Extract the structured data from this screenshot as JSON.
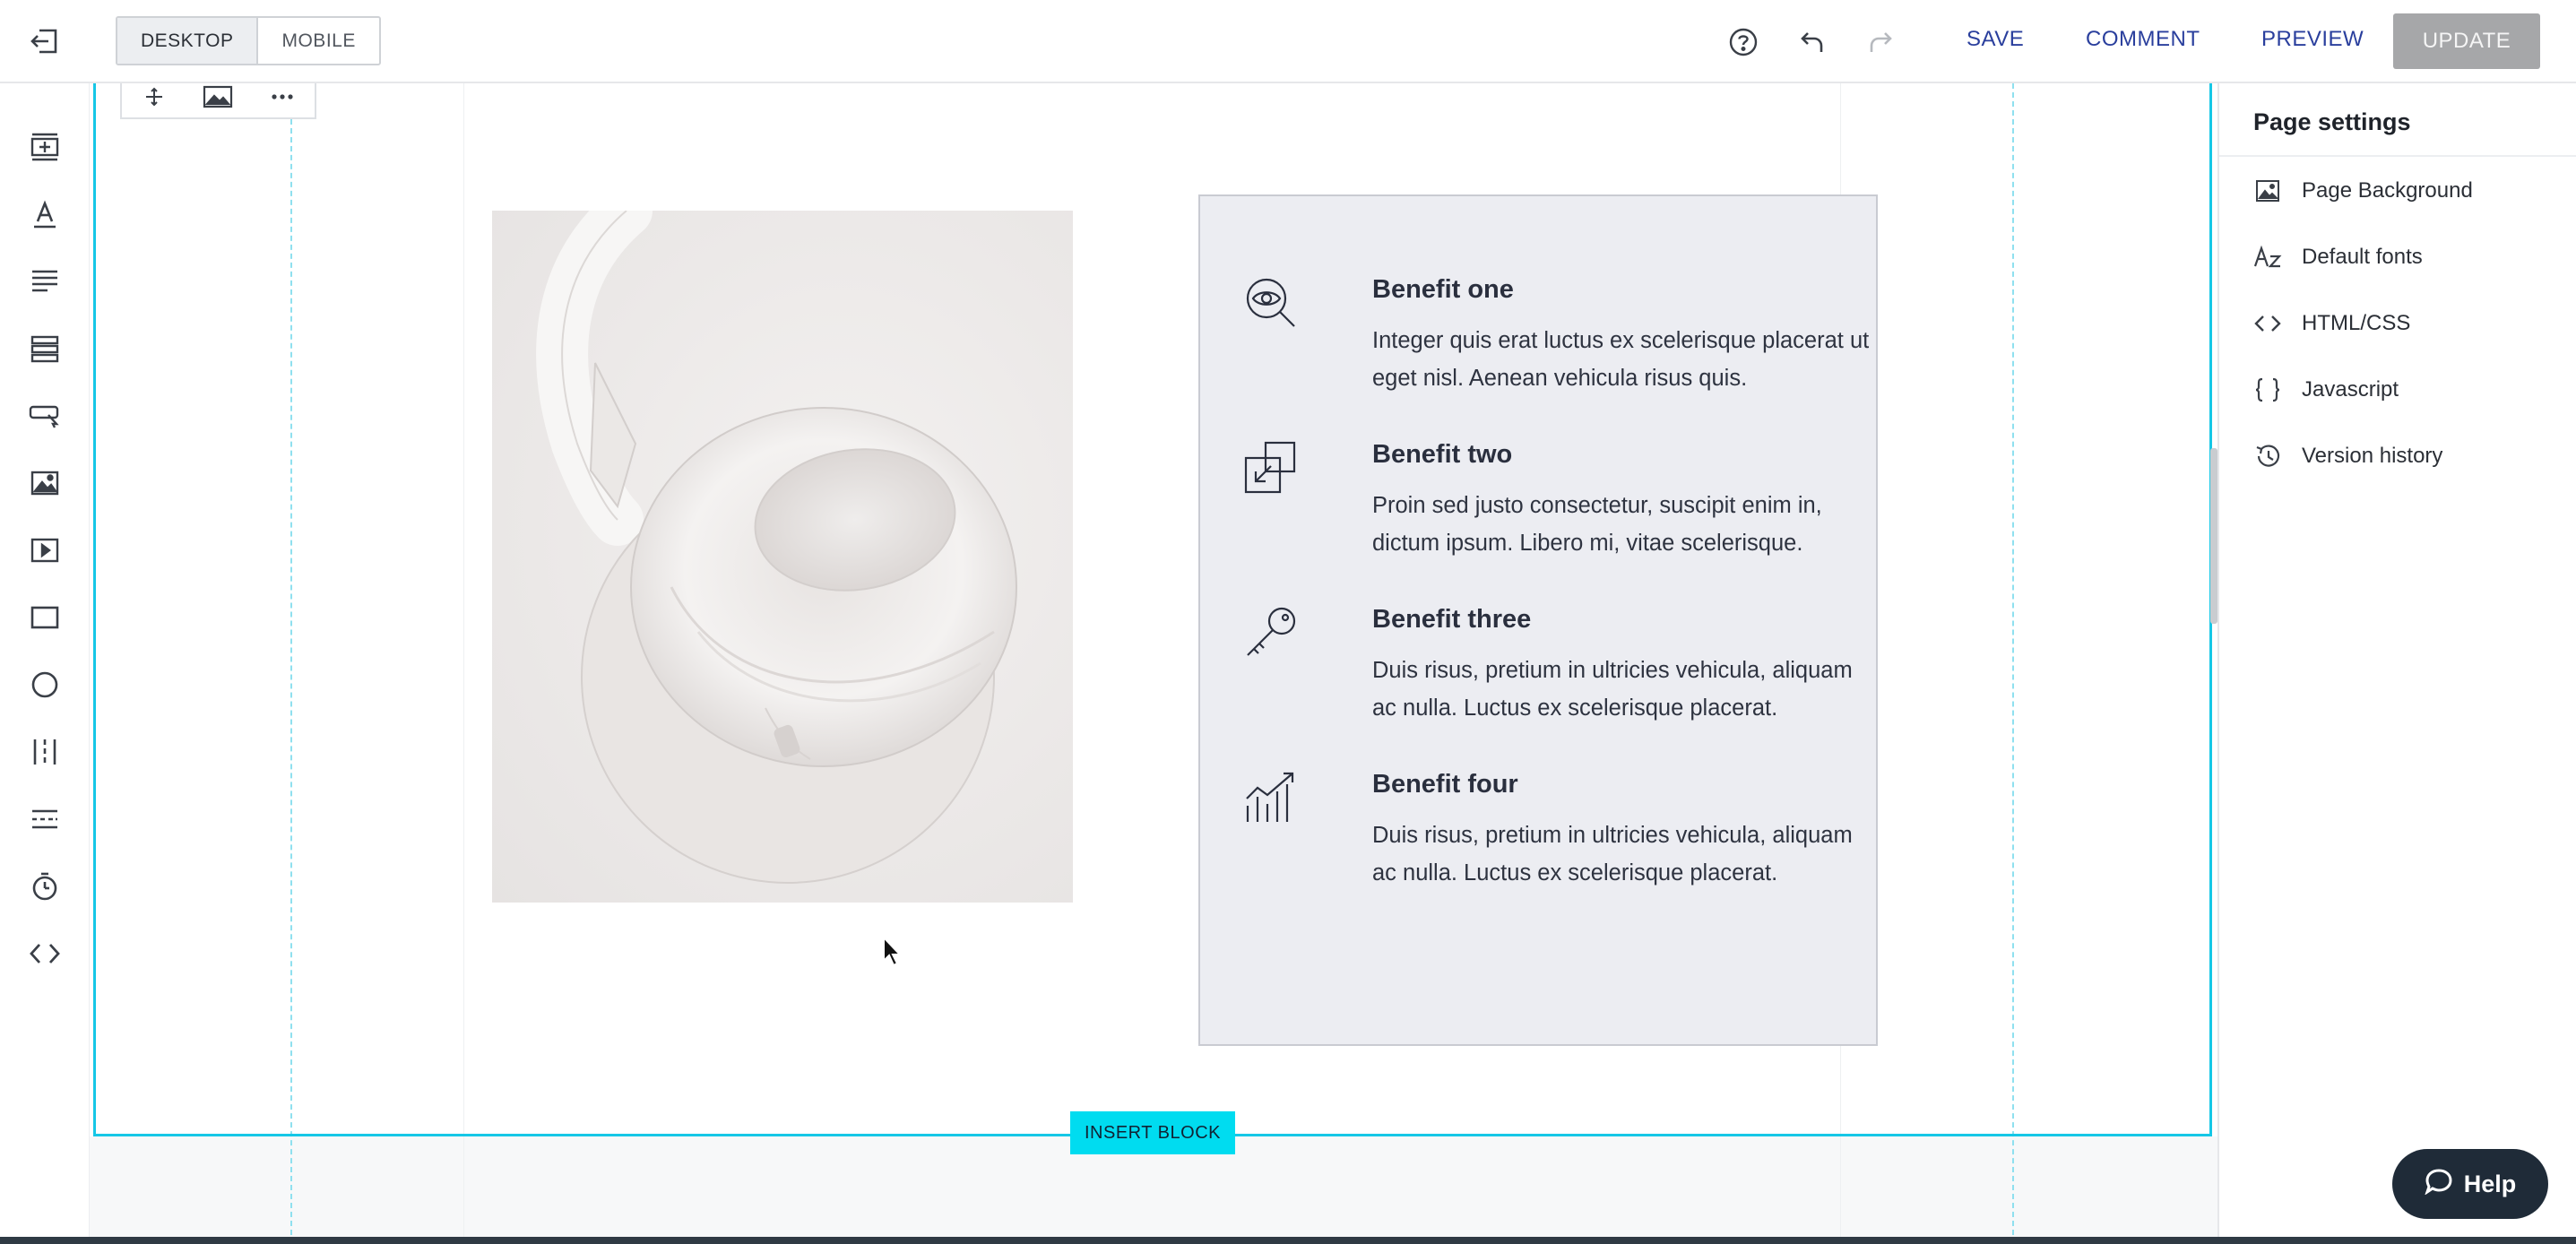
{
  "topbar": {
    "device_tabs": [
      {
        "label": "DESKTOP",
        "active": true
      },
      {
        "label": "MOBILE",
        "active": false
      }
    ],
    "actions": {
      "save": "SAVE",
      "comment": "COMMENT",
      "preview": "PREVIEW",
      "update": "UPDATE"
    },
    "icons": [
      "exit-editor-icon",
      "help-circle-icon",
      "undo-icon",
      "redo-icon"
    ]
  },
  "left_rail": {
    "tools": [
      "add-section-icon",
      "text-heading-icon",
      "paragraph-icon",
      "list-block-icon",
      "button-icon",
      "image-icon",
      "video-icon",
      "rectangle-icon",
      "circle-icon",
      "columns-icon",
      "divider-icon",
      "timer-icon",
      "code-icon"
    ]
  },
  "block_toolbar": {
    "icons": [
      "move-icon",
      "background-image-icon",
      "more-icon"
    ]
  },
  "benefits": [
    {
      "icon": "eye-search-icon",
      "title": "Benefit one",
      "text": "Integer quis erat luctus ex scelerisque placerat ut eget nisl. Aenean vehicula risus quis."
    },
    {
      "icon": "shrink-arrows-icon",
      "title": "Benefit two",
      "text": "Proin sed justo consectetur, suscipit enim in, dictum ipsum. Libero mi, vitae scelerisque."
    },
    {
      "icon": "key-icon",
      "title": "Benefit three",
      "text": "Duis risus, pretium in ultricies vehicula, aliquam ac nulla. Luctus ex scelerisque placerat."
    },
    {
      "icon": "growth-chart-icon",
      "title": "Benefit four",
      "text": "Duis risus, pretium in ultricies vehicula, aliquam ac nulla. Luctus ex scelerisque placerat."
    }
  ],
  "canvas": {
    "insert_block": "INSERT BLOCK",
    "image_subject": "white-headphones"
  },
  "right_panel": {
    "title": "Page settings",
    "items": [
      {
        "icon": "image-icon",
        "label": "Page Background"
      },
      {
        "icon": "font-icon",
        "label": "Default fonts"
      },
      {
        "icon": "code-icon",
        "label": "HTML/CSS"
      },
      {
        "icon": "braces-icon",
        "label": "Javascript"
      },
      {
        "icon": "history-icon",
        "label": "Version history"
      }
    ]
  },
  "help": {
    "label": "Help"
  },
  "colors": {
    "accent_cyan": "#16c7e6",
    "insert_block": "#00dcf0",
    "link_blue": "#2a3f9d",
    "card_bg": "#ecedf2",
    "help_bg": "#1f2b38"
  }
}
